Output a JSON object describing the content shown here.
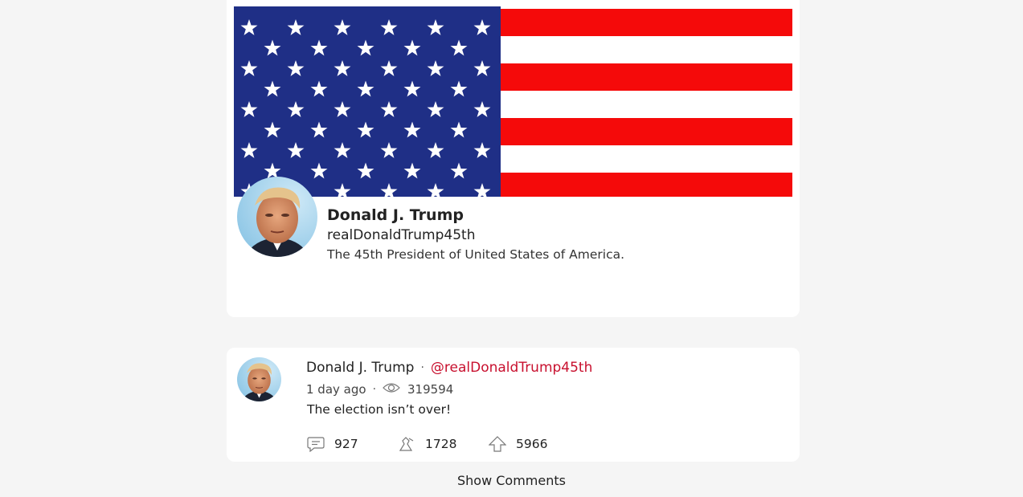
{
  "profile": {
    "name": "Donald J. Trump",
    "handle": "realDonaldTrump45th",
    "bio": "The 45th President of United States of America."
  },
  "post": {
    "author": "Donald J. Trump",
    "handle": "@realDonaldTrump45th",
    "time": "1 day ago",
    "views": "319594",
    "text": "The election isn’t over!",
    "comments": "927",
    "reposts": "1728",
    "upvotes": "5966"
  },
  "show_comments_label": "Show Comments",
  "colors": {
    "accent": "#c8102e",
    "flag_blue": "#1f2f86",
    "flag_red": "#f50a0a"
  }
}
